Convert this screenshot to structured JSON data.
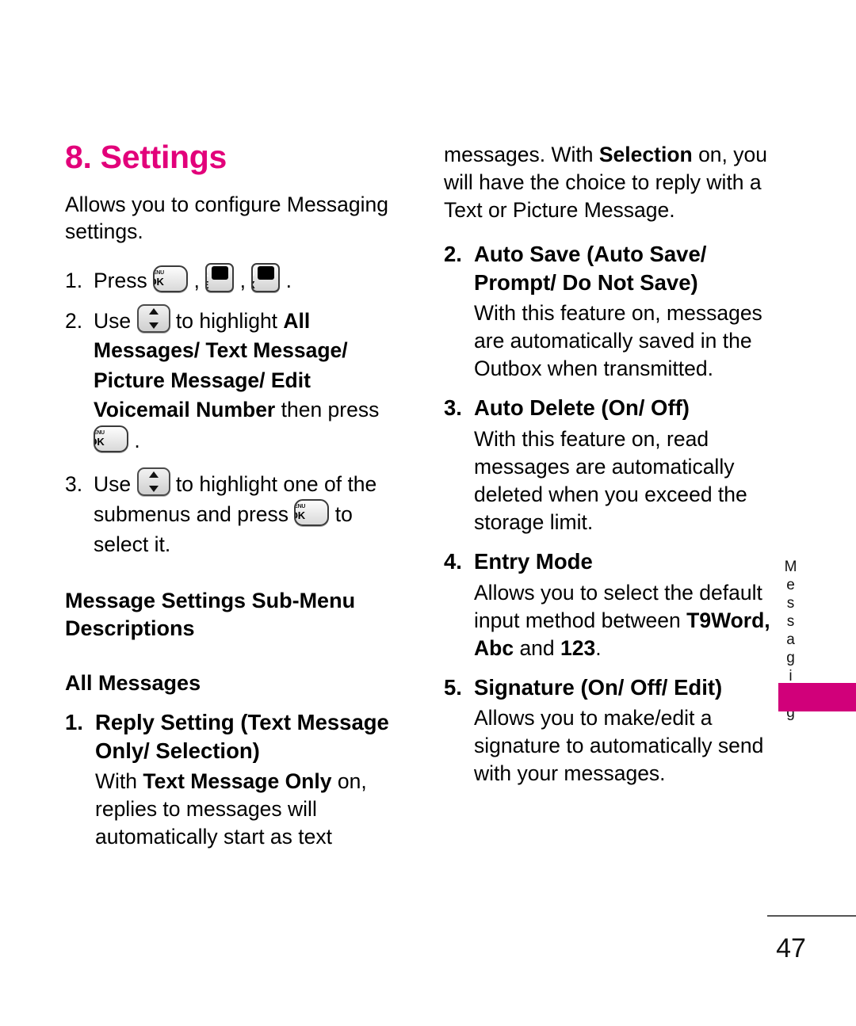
{
  "page": {
    "number": "47",
    "side_tab_label": "Messaging",
    "accent_color": "#E2007A",
    "tab_block_color": "#D1007A"
  },
  "icons": {
    "menu_ok": {
      "top": "MENU",
      "bottom": "OK"
    },
    "key_2": {
      "number": "2",
      "letter": "E"
    },
    "key_8": {
      "number": "8",
      "letter": "X"
    },
    "nav_updown": "up-down-navigation-key"
  },
  "left_column": {
    "chapter_title": "8. Settings",
    "intro": "Allows you to configure Messaging settings.",
    "step1": {
      "num": "1.",
      "lead": "Press ",
      "sep1": " , ",
      "sep2": " , ",
      "end": " ."
    },
    "step2": {
      "num": "2.",
      "lead": "Use ",
      "mid": " to highlight ",
      "bold_options": "All Messages/ Text Message/ Picture Message/ Edit Voicemail Number",
      "after_bold": " then press ",
      "end": " ."
    },
    "step3": {
      "num": "3.",
      "lead": "Use ",
      "mid": " to highlight one of the submenus and press ",
      "end": " to select it."
    },
    "section_heading": "Message Settings Sub-Menu Descriptions",
    "group_heading": "All Messages",
    "item1": {
      "num": "1.",
      "title": "Reply Setting (Text Message Only/ Selection)",
      "body_pre": "With ",
      "body_bold": "Text Message Only",
      "body_post": " on, replies to messages will automatically start as text"
    }
  },
  "right_column": {
    "continuation": {
      "pre": "messages. With ",
      "bold": "Selection",
      "post": " on, you will have the choice to reply with a Text or Picture Message."
    },
    "item2": {
      "num": "2.",
      "title": "Auto Save (Auto Save/ Prompt/ Do Not Save)",
      "body": "With this feature on, messages are automatically saved in the Outbox when transmitted."
    },
    "item3": {
      "num": "3.",
      "title": "Auto Delete (On/ Off)",
      "body": "With this feature on, read messages are automatically deleted when you exceed the storage limit."
    },
    "item4": {
      "num": "4.",
      "title": "Entry Mode",
      "body_pre": "Allows you to select the default input method between ",
      "body_bold1": "T9Word, Abc",
      "body_mid": " and ",
      "body_bold2": "123",
      "body_post": "."
    },
    "item5": {
      "num": "5.",
      "title": "Signature (On/ Off/ Edit)",
      "body": "Allows you to make/edit a signature to automatically send with your messages."
    }
  }
}
